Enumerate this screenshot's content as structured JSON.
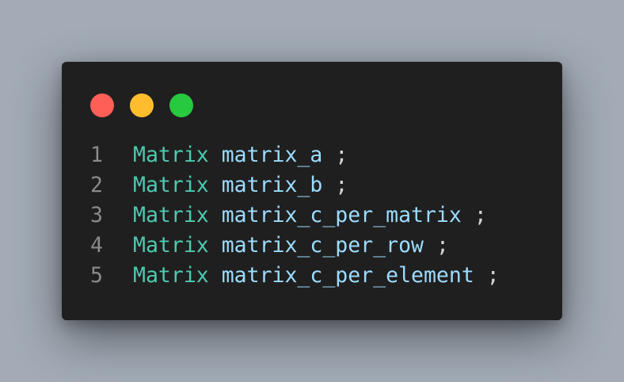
{
  "window": {
    "controls": {
      "close_color": "#ff5f56",
      "minimize_color": "#ffbd2e",
      "maximize_color": "#27c93f"
    }
  },
  "theme": {
    "background": "#a2abb6",
    "editor_background": "#1f1f1f",
    "line_number_color": "#8a8a8a",
    "type_color": "#4ec9b0",
    "identifier_color": "#9cdcfe",
    "punctuation_color": "#d4d4d4"
  },
  "code": {
    "lines": [
      {
        "number": "1",
        "type": "Matrix",
        "name": "matrix_a",
        "end": ";"
      },
      {
        "number": "2",
        "type": "Matrix",
        "name": "matrix_b",
        "end": ";"
      },
      {
        "number": "3",
        "type": "Matrix",
        "name": "matrix_c_per_matrix",
        "end": ";"
      },
      {
        "number": "4",
        "type": "Matrix",
        "name": "matrix_c_per_row",
        "end": ";"
      },
      {
        "number": "5",
        "type": "Matrix",
        "name": "matrix_c_per_element",
        "end": ";"
      }
    ]
  }
}
